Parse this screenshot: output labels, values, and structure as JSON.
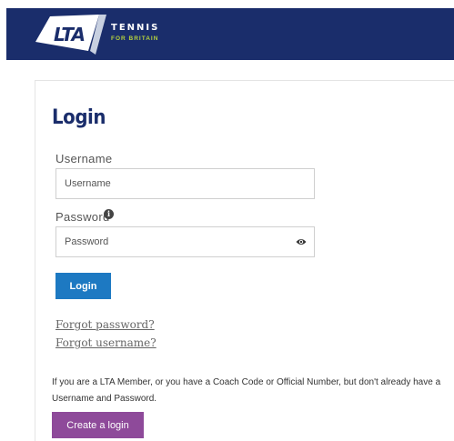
{
  "header": {
    "logo_mark": "LTA",
    "logo_name": "TENNIS",
    "logo_tagline": "FOR BRITAIN",
    "background_color": "#1a2d6b"
  },
  "form": {
    "title": "Login",
    "username_label": "Username",
    "username_placeholder": "Username",
    "username_value": "",
    "password_label": "Password",
    "password_placeholder": "Password",
    "password_value": "",
    "info_icon": "info-icon",
    "password_toggle_icon": "eye-icon",
    "login_button_label": "Login",
    "login_button_color": "#1d79c2"
  },
  "links": {
    "forgot_password": "Forgot password?",
    "forgot_username": "Forgot username?"
  },
  "signup": {
    "info_text": "If you are a LTA Member, or you have a Coach Code or Official Number, but don't already have a Username and Password.",
    "create_button_label": "Create a login",
    "create_button_color": "#8e4a9a"
  }
}
